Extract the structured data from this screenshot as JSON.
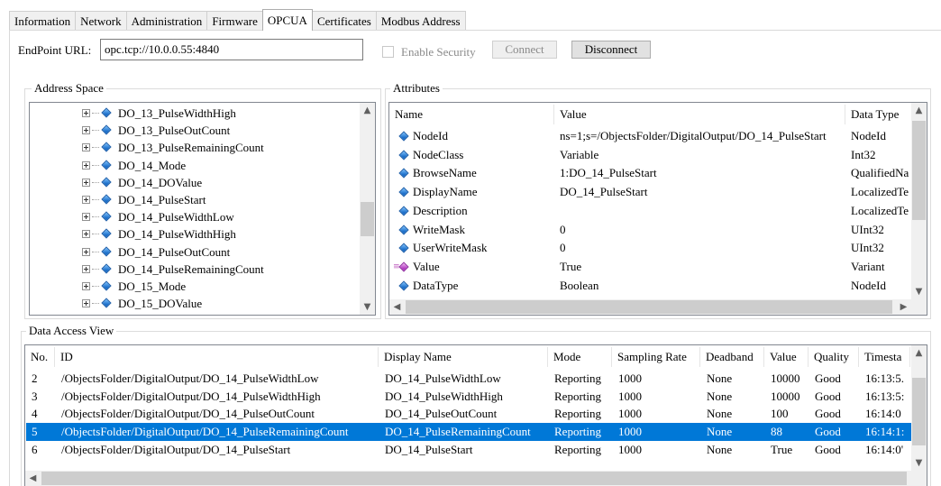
{
  "tabs": [
    {
      "label": "Information",
      "active": false
    },
    {
      "label": "Network",
      "active": false
    },
    {
      "label": "Administration",
      "active": false
    },
    {
      "label": "Firmware",
      "active": false
    },
    {
      "label": "OPCUA",
      "active": true
    },
    {
      "label": "Certificates",
      "active": false
    },
    {
      "label": "Modbus Address",
      "active": false
    }
  ],
  "endpoint": {
    "label": "EndPoint URL:",
    "value": "opc.tcp://10.0.0.55:4840",
    "enable_security_label": "Enable Security",
    "enable_security_checked": false,
    "connect_label": "Connect",
    "connect_enabled": false,
    "disconnect_label": "Disconnect"
  },
  "address_space": {
    "title": "Address Space",
    "items": [
      "DO_13_PulseWidthHigh",
      "DO_13_PulseOutCount",
      "DO_13_PulseRemainingCount",
      "DO_14_Mode",
      "DO_14_DOValue",
      "DO_14_PulseStart",
      "DO_14_PulseWidthLow",
      "DO_14_PulseWidthHigh",
      "DO_14_PulseOutCount",
      "DO_14_PulseRemainingCount",
      "DO_15_Mode",
      "DO_15_DOValue"
    ]
  },
  "attributes": {
    "title": "Attributes",
    "columns": [
      "Name",
      "Value",
      "Data Type"
    ],
    "rows": [
      {
        "name": "NodeId",
        "value": "ns=1;s=/ObjectsFolder/DigitalOutput/DO_14_PulseStart",
        "type": "NodeId",
        "icon": "property-icon"
      },
      {
        "name": "NodeClass",
        "value": "Variable",
        "type": "Int32",
        "icon": "property-icon"
      },
      {
        "name": "BrowseName",
        "value": "1:DO_14_PulseStart",
        "type": "QualifiedNa",
        "icon": "property-icon"
      },
      {
        "name": "DisplayName",
        "value": "DO_14_PulseStart",
        "type": "LocalizedTe",
        "icon": "property-icon"
      },
      {
        "name": "Description",
        "value": "",
        "type": "LocalizedTe",
        "icon": "property-icon"
      },
      {
        "name": "WriteMask",
        "value": "0",
        "type": "UInt32",
        "icon": "property-icon"
      },
      {
        "name": "UserWriteMask",
        "value": "0",
        "type": "UInt32",
        "icon": "property-icon"
      },
      {
        "name": "Value",
        "value": "True",
        "type": "Variant",
        "icon": "value-property-icon"
      },
      {
        "name": "DataType",
        "value": "Boolean",
        "type": "NodeId",
        "icon": "property-icon"
      }
    ]
  },
  "data_access": {
    "title": "Data Access View",
    "columns": [
      "No.",
      "ID",
      "Display Name",
      "Mode",
      "Sampling Rate",
      "Deadband",
      "Value",
      "Quality",
      "Timesta"
    ],
    "selected_index": 3,
    "rows": [
      {
        "no": "2",
        "id": "/ObjectsFolder/DigitalOutput/DO_14_PulseWidthLow",
        "display": "DO_14_PulseWidthLow",
        "mode": "Reporting",
        "rate": "1000",
        "deadband": "None",
        "value": "10000",
        "quality": "Good",
        "ts": "16:13:5."
      },
      {
        "no": "3",
        "id": "/ObjectsFolder/DigitalOutput/DO_14_PulseWidthHigh",
        "display": "DO_14_PulseWidthHigh",
        "mode": "Reporting",
        "rate": "1000",
        "deadband": "None",
        "value": "10000",
        "quality": "Good",
        "ts": "16:13:5:"
      },
      {
        "no": "4",
        "id": "/ObjectsFolder/DigitalOutput/DO_14_PulseOutCount",
        "display": "DO_14_PulseOutCount",
        "mode": "Reporting",
        "rate": "1000",
        "deadband": "None",
        "value": "100",
        "quality": "Good",
        "ts": "16:14:0"
      },
      {
        "no": "5",
        "id": "/ObjectsFolder/DigitalOutput/DO_14_PulseRemainingCount",
        "display": "DO_14_PulseRemainingCount",
        "mode": "Reporting",
        "rate": "1000",
        "deadband": "None",
        "value": "88",
        "quality": "Good",
        "ts": "16:14:1:"
      },
      {
        "no": "6",
        "id": "/ObjectsFolder/DigitalOutput/DO_14_PulseStart",
        "display": "DO_14_PulseStart",
        "mode": "Reporting",
        "rate": "1000",
        "deadband": "None",
        "value": "True",
        "quality": "Good",
        "ts": "16:14:0'"
      }
    ]
  },
  "colors": {
    "selection": "#0078d7",
    "selection_text": "#ffffff",
    "disabled_text": "#8a8a8a"
  }
}
